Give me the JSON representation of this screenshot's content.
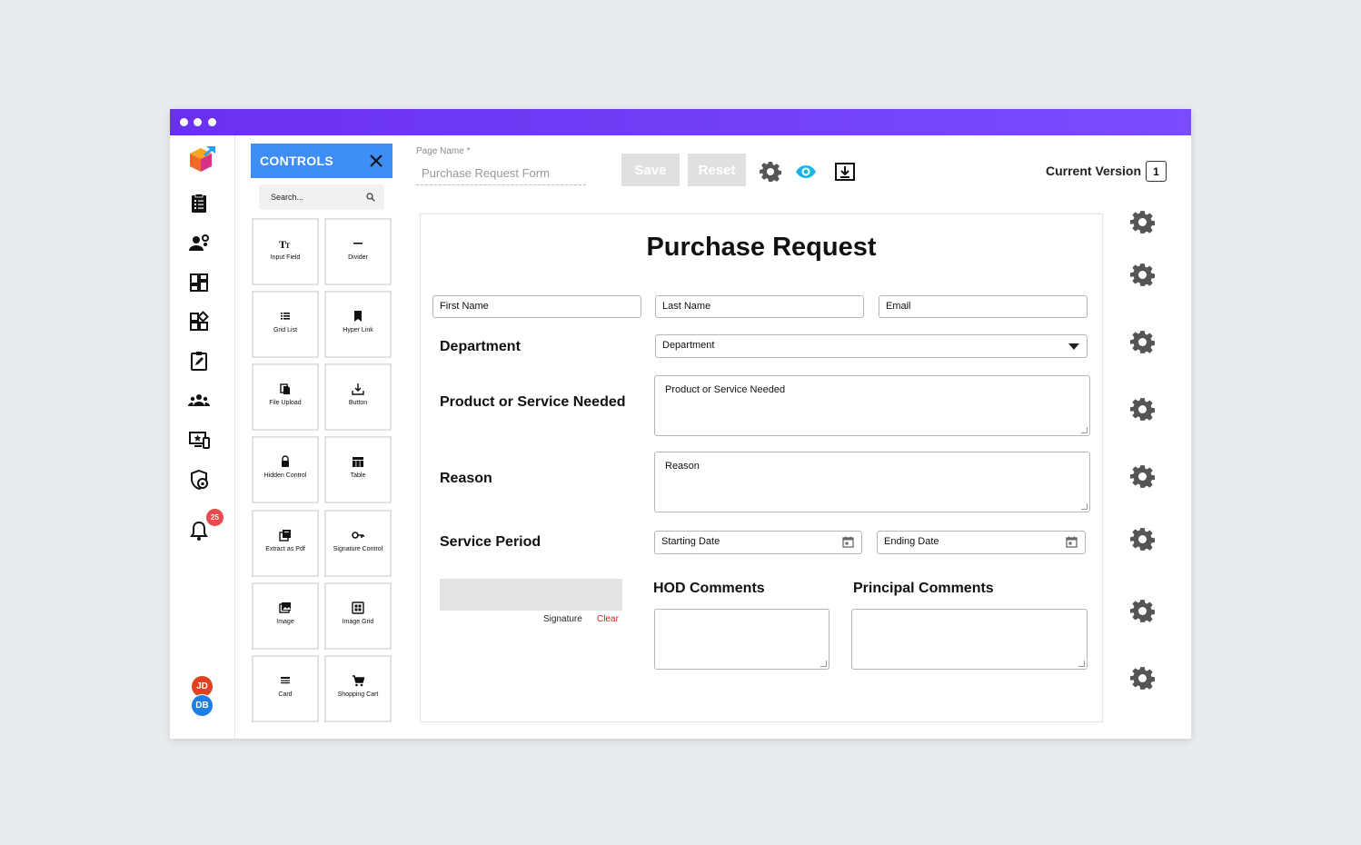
{
  "window": {
    "accent": "#6a30f0"
  },
  "sidebar": {
    "icons": [
      "app-logo-icon",
      "clipboard-icon",
      "users-settings-icon",
      "dashboard-icon",
      "widgets-icon",
      "edit-icon",
      "groups-icon",
      "screen-star-icon",
      "shield-icon",
      "bell-icon"
    ],
    "notification_count": "25",
    "avatars": [
      {
        "initials": "JD",
        "color": "#e0421f"
      },
      {
        "initials": "DB",
        "color": "#1e7ee8"
      }
    ]
  },
  "controls": {
    "title": "CONTROLS",
    "search_placeholder": "Search...",
    "tiles": [
      {
        "label": "Input Field",
        "icon": "text-icon"
      },
      {
        "label": "Divider",
        "icon": "divider-icon"
      },
      {
        "label": "Grid List",
        "icon": "list-icon"
      },
      {
        "label": "Hyper Link",
        "icon": "bookmark-icon"
      },
      {
        "label": "File Upload",
        "icon": "file-copy-icon"
      },
      {
        "label": "Button",
        "icon": "download-icon"
      },
      {
        "label": "Hidden Control",
        "icon": "lock-icon"
      },
      {
        "label": "Table",
        "icon": "table-icon"
      },
      {
        "label": "Extract as Pdf",
        "icon": "pdf-icon"
      },
      {
        "label": "Signature Control",
        "icon": "key-icon"
      },
      {
        "label": "Image",
        "icon": "image-icon"
      },
      {
        "label": "Image Grid",
        "icon": "image-grid-icon"
      },
      {
        "label": "Card",
        "icon": "card-icon"
      },
      {
        "label": "Shopping Cart",
        "icon": "cart-icon"
      }
    ]
  },
  "toolbar": {
    "page_name_label": "Page Name *",
    "page_name_value": "Purchase Request Form",
    "save_label": "Save",
    "reset_label": "Reset",
    "version_label": "Current Version",
    "version_value": "1"
  },
  "form": {
    "title": "Purchase Request",
    "first_name": "First Name",
    "last_name": "Last Name",
    "email": "Email",
    "department_label": "Department",
    "department_select": "Department",
    "product_label": "Product or Service Needed",
    "product_placeholder": "Product or Service Needed",
    "reason_label": "Reason",
    "reason_placeholder": "Reason",
    "service_period_label": "Service Period",
    "starting_date": "Starting Date",
    "ending_date": "Ending Date",
    "signature_label": "Signature",
    "clear_label": "Clear",
    "hod_label": "HOD Comments",
    "principal_label": "Principal Comments"
  }
}
